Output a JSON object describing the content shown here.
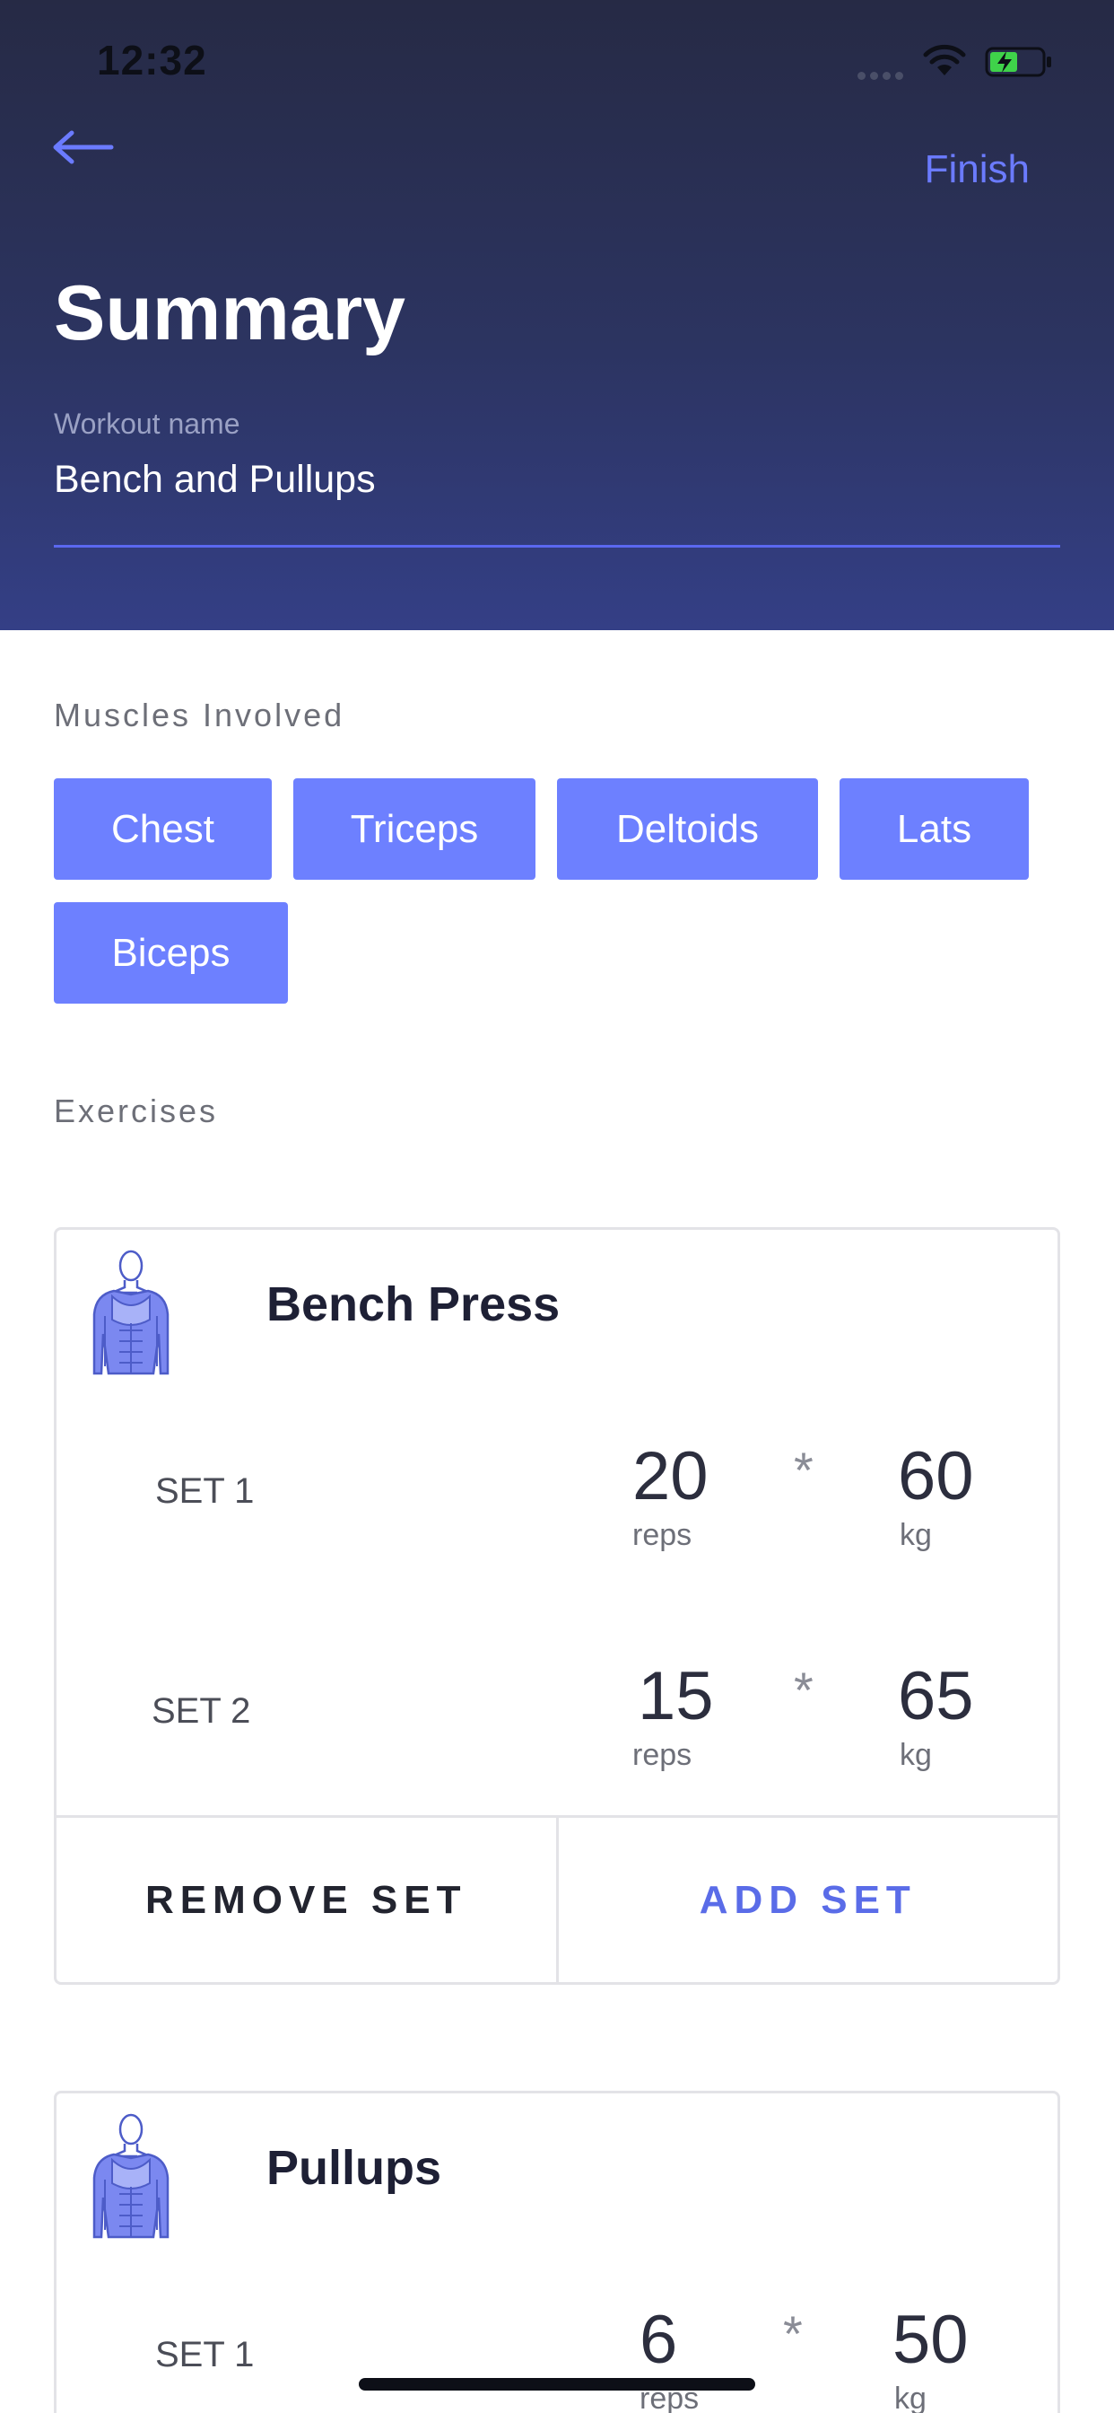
{
  "status_bar": {
    "time": "12:32"
  },
  "header": {
    "finish_label": "Finish",
    "title": "Summary",
    "workout_label": "Workout name",
    "workout_name": "Bench and Pullups"
  },
  "muscles": {
    "label": "Muscles Involved",
    "tags": [
      "Chest",
      "Triceps",
      "Deltoids",
      "Lats",
      "Biceps"
    ]
  },
  "exercises": {
    "label": "Exercises",
    "items": [
      {
        "name": "Bench Press",
        "sets": [
          {
            "label": "SET 1",
            "reps": "20",
            "reps_unit": "reps",
            "times": "*",
            "weight": "60",
            "weight_unit": "kg"
          },
          {
            "label": "SET 2",
            "reps": "15",
            "reps_unit": "reps",
            "times": "*",
            "weight": "65",
            "weight_unit": "kg"
          }
        ],
        "remove_label": "REMOVE SET",
        "add_label": "ADD SET"
      },
      {
        "name": "Pullups",
        "sets": [
          {
            "label": "SET 1",
            "reps": "6",
            "reps_unit": "reps",
            "times": "*",
            "weight": "50",
            "weight_unit": "kg"
          }
        ]
      }
    ]
  },
  "colors": {
    "accent": "#6d80ff",
    "link": "#6b7bff",
    "header_top": "#262a45",
    "header_bottom": "#343f86"
  }
}
